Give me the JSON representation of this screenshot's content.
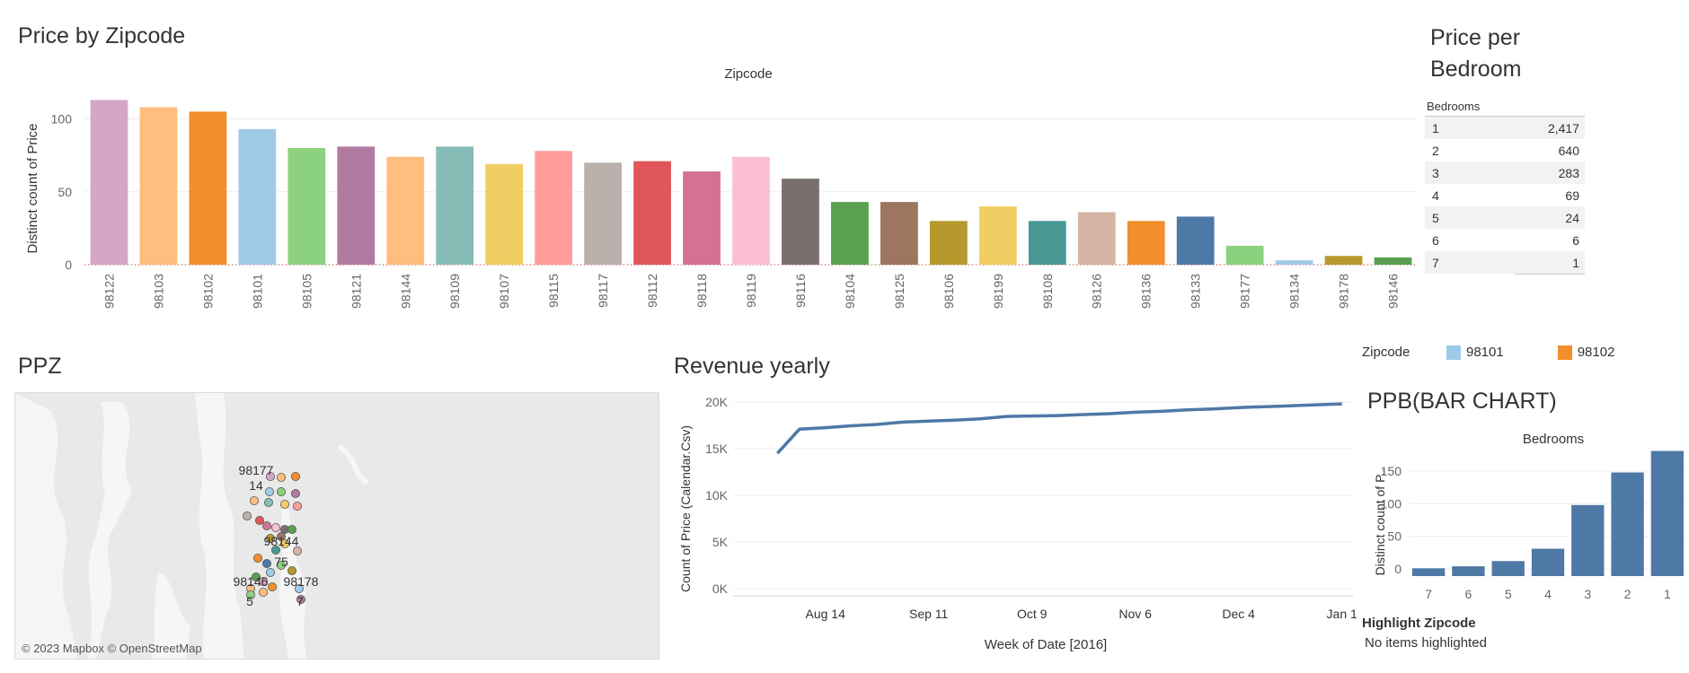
{
  "titles": {
    "price_by_zip": "Price by Zipcode",
    "ppb": "Price per Bedroom",
    "ppz": "PPZ",
    "revenue": "Revenue yearly",
    "ppb_bar": "PPB(BAR CHART)"
  },
  "ppb_table": {
    "header": "Bedrooms",
    "rows": [
      {
        "bedrooms": "1",
        "value": "2,417"
      },
      {
        "bedrooms": "2",
        "value": "640"
      },
      {
        "bedrooms": "3",
        "value": "283"
      },
      {
        "bedrooms": "4",
        "value": "69"
      },
      {
        "bedrooms": "5",
        "value": "24"
      },
      {
        "bedrooms": "6",
        "value": "6"
      },
      {
        "bedrooms": "7",
        "value": "1"
      }
    ]
  },
  "map": {
    "credit": "© 2023 Mapbox © OpenStreetMap",
    "labels": [
      "98177",
      "14",
      "98144",
      "75",
      "98146",
      "98178",
      "5",
      "7"
    ]
  },
  "legend": {
    "title": "Zipcode",
    "items": [
      {
        "label": "98101",
        "color": "#9ecae9"
      },
      {
        "label": "98102",
        "color": "#f28e2b"
      }
    ]
  },
  "highlight": {
    "title": "Highlight Zipcode",
    "value": "No items highlighted"
  },
  "chart_data": [
    {
      "type": "bar",
      "title": "Zipcode",
      "ylabel": "Distinct count of Price",
      "ylim": [
        0,
        120
      ],
      "yticks": [
        0,
        50,
        100
      ],
      "categories": [
        "98122",
        "98103",
        "98102",
        "98101",
        "98105",
        "98121",
        "98144",
        "98109",
        "98107",
        "98115",
        "98117",
        "98112",
        "98118",
        "98119",
        "98116",
        "98104",
        "98125",
        "98106",
        "98199",
        "98108",
        "98126",
        "98136",
        "98133",
        "98177",
        "98134",
        "98178",
        "98146"
      ],
      "values": [
        113,
        108,
        105,
        93,
        80,
        81,
        74,
        81,
        69,
        78,
        70,
        71,
        64,
        74,
        59,
        43,
        43,
        30,
        40,
        30,
        36,
        30,
        33,
        13,
        3,
        6,
        5
      ],
      "colors": [
        "#d4a6c8",
        "#ffbe7d",
        "#f28e2b",
        "#a0cbe8",
        "#8cd17d",
        "#b07aa1",
        "#ffbe7d",
        "#86bcb6",
        "#f1ce63",
        "#ff9d9a",
        "#bab0ac",
        "#e15759",
        "#d37295",
        "#fabfd2",
        "#79706e",
        "#59a14f",
        "#9d7660",
        "#b6992d",
        "#f1ce63",
        "#499894",
        "#d7b5a6",
        "#f28e2b",
        "#4e79a7",
        "#8cd17d",
        "#a0cbe8",
        "#b6992d",
        "#59a14f"
      ]
    },
    {
      "type": "line",
      "ylabel": "Count of Price (Calendar.Csv)",
      "xlabel": "Week of Date [2016]",
      "ylim": [
        0,
        20000
      ],
      "yticks": [
        "0K",
        "5K",
        "10K",
        "15K",
        "20K"
      ],
      "xticks": [
        "Aug 14",
        "Sep 11",
        "Oct 9",
        "Nov 6",
        "Dec 4",
        "Jan 1"
      ],
      "x": [
        "2016-08-01",
        "2016-08-07",
        "2016-08-14",
        "2016-08-21",
        "2016-08-28",
        "2016-09-04",
        "2016-09-11",
        "2016-09-18",
        "2016-09-25",
        "2016-10-02",
        "2016-10-09",
        "2016-10-16",
        "2016-10-23",
        "2016-10-30",
        "2016-11-06",
        "2016-11-13",
        "2016-11-20",
        "2016-11-27",
        "2016-12-04",
        "2016-12-11",
        "2016-12-18",
        "2016-12-25",
        "2017-01-01"
      ],
      "values": [
        14500,
        17100,
        17250,
        17450,
        17600,
        17850,
        17950,
        18050,
        18200,
        18450,
        18500,
        18550,
        18650,
        18750,
        18900,
        19000,
        19150,
        19250,
        19400,
        19500,
        19600,
        19700,
        19800
      ],
      "color": "#4e79a7"
    },
    {
      "type": "bar",
      "title": "Bedrooms",
      "ylabel": "Distinct count of P..",
      "ylim": [
        0,
        190
      ],
      "yticks": [
        0,
        50,
        100,
        150
      ],
      "categories": [
        "7",
        "6",
        "5",
        "4",
        "3",
        "2",
        "1"
      ],
      "values": [
        1,
        4,
        12,
        31,
        98,
        148,
        181
      ],
      "color": "#4e79a7"
    }
  ]
}
